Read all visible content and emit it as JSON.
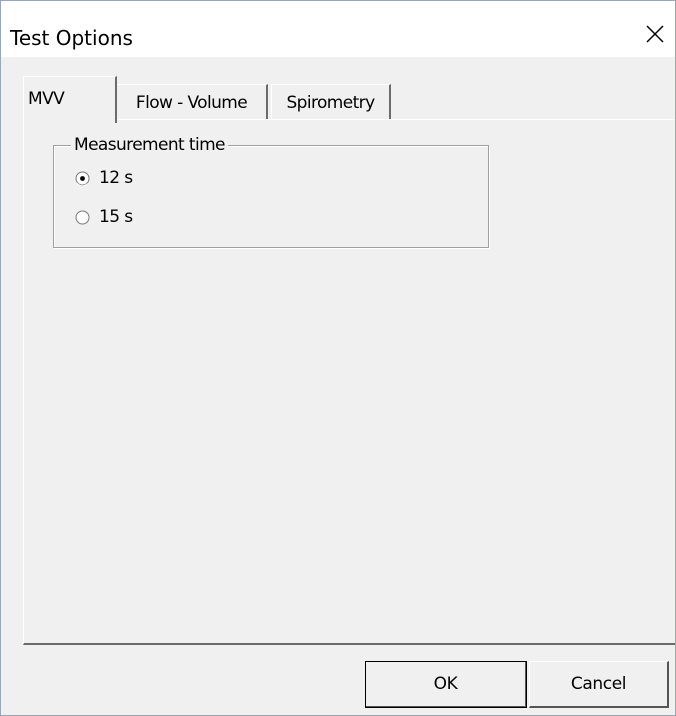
{
  "window": {
    "title": "Test Options",
    "close_icon": "close-icon"
  },
  "tabs": [
    {
      "label": "MVV",
      "selected": true
    },
    {
      "label": "Flow - Volume",
      "selected": false
    },
    {
      "label": "Spirometry",
      "selected": false
    }
  ],
  "measurement_group": {
    "label": "Measurement time",
    "options": [
      {
        "label": "12 s",
        "checked": true
      },
      {
        "label": "15 s",
        "checked": false
      }
    ]
  },
  "buttons": {
    "ok": "OK",
    "cancel": "Cancel"
  },
  "colors": {
    "titlebar": "#ffffff",
    "face": "#f0f0f0",
    "shadow": "#6b6b6b",
    "highlight": "#ffffff"
  }
}
